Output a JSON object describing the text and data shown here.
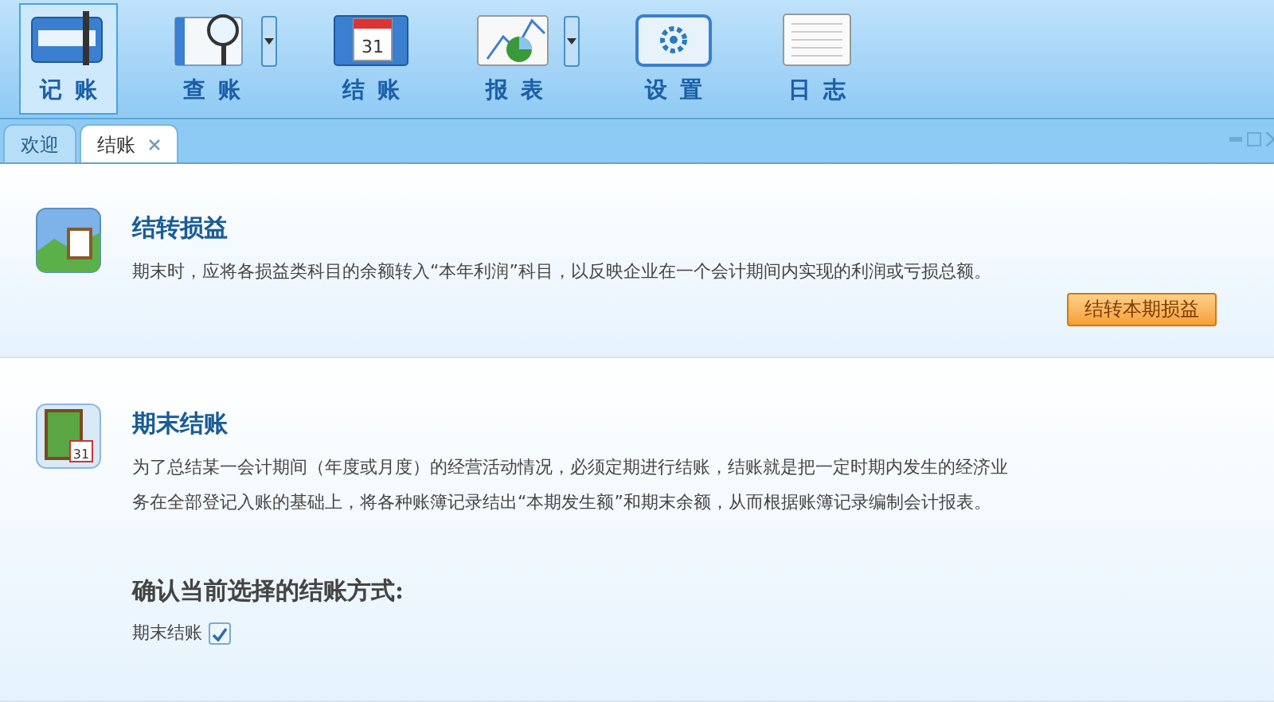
{
  "toolbar": [
    {
      "label": "记账",
      "kind": "ledger",
      "selected": true,
      "dropdown": false
    },
    {
      "label": "查账",
      "kind": "search",
      "selected": false,
      "dropdown": true
    },
    {
      "label": "结账",
      "kind": "calendar",
      "calendar_day": "31",
      "selected": false,
      "dropdown": false
    },
    {
      "label": "报表",
      "kind": "chart",
      "selected": false,
      "dropdown": true
    },
    {
      "label": "设置",
      "kind": "gear",
      "selected": false,
      "dropdown": false
    },
    {
      "label": "日志",
      "kind": "log",
      "selected": false,
      "dropdown": false
    }
  ],
  "tabs": [
    {
      "label": "欢迎",
      "selected": false,
      "closable": false
    },
    {
      "label": "结账",
      "selected": true,
      "closable": true
    }
  ],
  "sections": [
    {
      "kind": "transfer",
      "title": "结转损益",
      "description": "期末时，应将各损益类科目的余额转入“本年利润”科目，以反映企业在一个会计期间内实现的利润或亏损总额。",
      "button": "结转本期损益"
    },
    {
      "kind": "closing",
      "calendar_day": "31",
      "title": "期末结账",
      "description": "为了总结某一会计期间（年度或月度）的经营活动情况，必须定期进行结账，结账就是把一定时期内发生的经济业务在全部登记入账的基础上，将各种账簿记录结出“本期发生额”和期末余额，从而根据账簿记录编制会计报表。",
      "confirm": "确认当前选择的结账方式:",
      "options": [
        {
          "label": "期末结账",
          "checked": true
        }
      ]
    }
  ]
}
